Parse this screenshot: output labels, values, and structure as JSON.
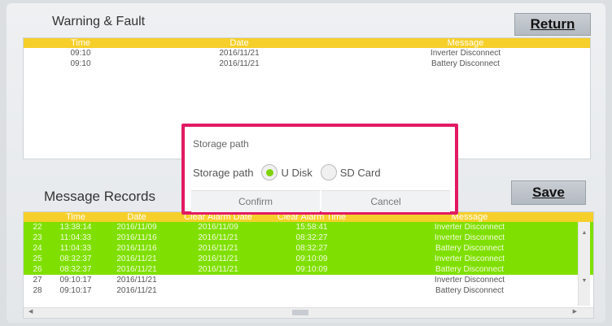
{
  "warning": {
    "title": "Warning & Fault",
    "return_label": "Return",
    "columns": [
      "Time",
      "Date",
      "Message"
    ],
    "rows": [
      {
        "time": "09:10",
        "date": "2016/11/21",
        "message": "Inverter Disconnect"
      },
      {
        "time": "09:10",
        "date": "2016/11/21",
        "message": "Battery Disconnect"
      }
    ]
  },
  "records": {
    "title": "Message Records",
    "save_label": "Save",
    "columns": [
      "",
      "Time",
      "Date",
      "Clear Alarm Date",
      "Clear Alarm Time",
      "Message"
    ],
    "rows": [
      {
        "no": "22",
        "time": "13:38:14",
        "date": "2016/11/09",
        "cdate": "2016/11/09",
        "ctime": "15:58:41",
        "message": "Inverter Disconnect",
        "color": "green"
      },
      {
        "no": "23",
        "time": "11:04:33",
        "date": "2016/11/16",
        "cdate": "2016/11/21",
        "ctime": "08:32:27",
        "message": "Inverter Disconnect",
        "color": "green"
      },
      {
        "no": "24",
        "time": "11:04:33",
        "date": "2016/11/16",
        "cdate": "2016/11/21",
        "ctime": "08:32:27",
        "message": "Battery Disconnect",
        "color": "green"
      },
      {
        "no": "25",
        "time": "08:32:37",
        "date": "2016/11/21",
        "cdate": "2016/11/21",
        "ctime": "09:10:09",
        "message": "Inverter Disconnect",
        "color": "green"
      },
      {
        "no": "26",
        "time": "08:32:37",
        "date": "2016/11/21",
        "cdate": "2016/11/21",
        "ctime": "09:10:09",
        "message": "Battery Disconnect",
        "color": "green"
      },
      {
        "no": "27",
        "time": "09:10:17",
        "date": "2016/11/21",
        "cdate": "",
        "ctime": "",
        "message": "Inverter Disconnect",
        "color": "white"
      },
      {
        "no": "28",
        "time": "09:10:17",
        "date": "2016/11/21",
        "cdate": "",
        "ctime": "",
        "message": "Battery Disconnect",
        "color": "white"
      }
    ]
  },
  "dialog": {
    "title": "Storage path",
    "path_label": "Storage path",
    "option_udisk": "U Disk",
    "option_sdcard": "SD Card",
    "selected": "U Disk",
    "confirm_label": "Confirm",
    "cancel_label": "Cancel"
  },
  "colors": {
    "header_yellow": "#f6cf2a",
    "row_green": "#7fe000",
    "highlight_pink": "#e21a63"
  },
  "icons": {
    "scroll_up": "▲",
    "scroll_down": "▼",
    "scroll_left": "◀",
    "scroll_right": "▶"
  }
}
